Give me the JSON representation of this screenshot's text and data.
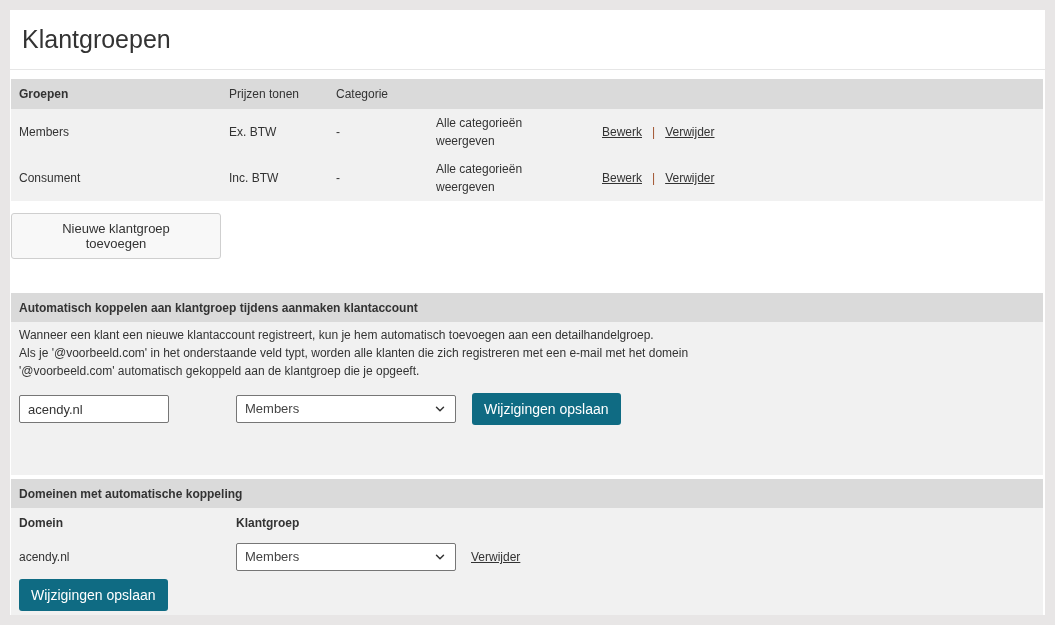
{
  "title": "Klantgroepen",
  "groups_table": {
    "columns": [
      "Groepen",
      "Prijzen tonen",
      "Categorie"
    ],
    "rows": [
      {
        "name": "Members",
        "prices": "Ex. BTW",
        "category": "-",
        "display": "Alle categorieën weergeven",
        "edit": "Bewerk",
        "separator": "|",
        "delete": "Verwijder"
      },
      {
        "name": "Consument",
        "prices": "Inc. BTW",
        "category": "-",
        "display": "Alle categorieën weergeven",
        "edit": "Bewerk",
        "separator": "|",
        "delete": "Verwijder"
      }
    ]
  },
  "add_button": "Nieuwe klantgroep toevoegen",
  "auto_link": {
    "heading": "Automatisch koppelen aan klantgroep tijdens aanmaken klantaccount",
    "description": [
      "Wanneer een klant een nieuwe klantaccount registreert, kun je hem automatisch toevoegen aan een detailhandelgroep.",
      "Als je '@voorbeeld.com' in het onderstaande veld typt, worden alle klanten die zich registreren met een e-mail met het domein '@voorbeeld.com' automatisch gekoppeld aan de klantgroep die je opgeeft."
    ],
    "domain_value": "acendy.nl",
    "group_value": "Members",
    "save_button": "Wijzigingen opslaan"
  },
  "domains": {
    "heading": "Domeinen met automatische koppeling",
    "columns": [
      "Domein",
      "Klantgroep"
    ],
    "rows": [
      {
        "domain": "acendy.nl",
        "group": "Members",
        "delete": "Verwijder"
      }
    ],
    "save_button": "Wijzigingen opslaan"
  }
}
